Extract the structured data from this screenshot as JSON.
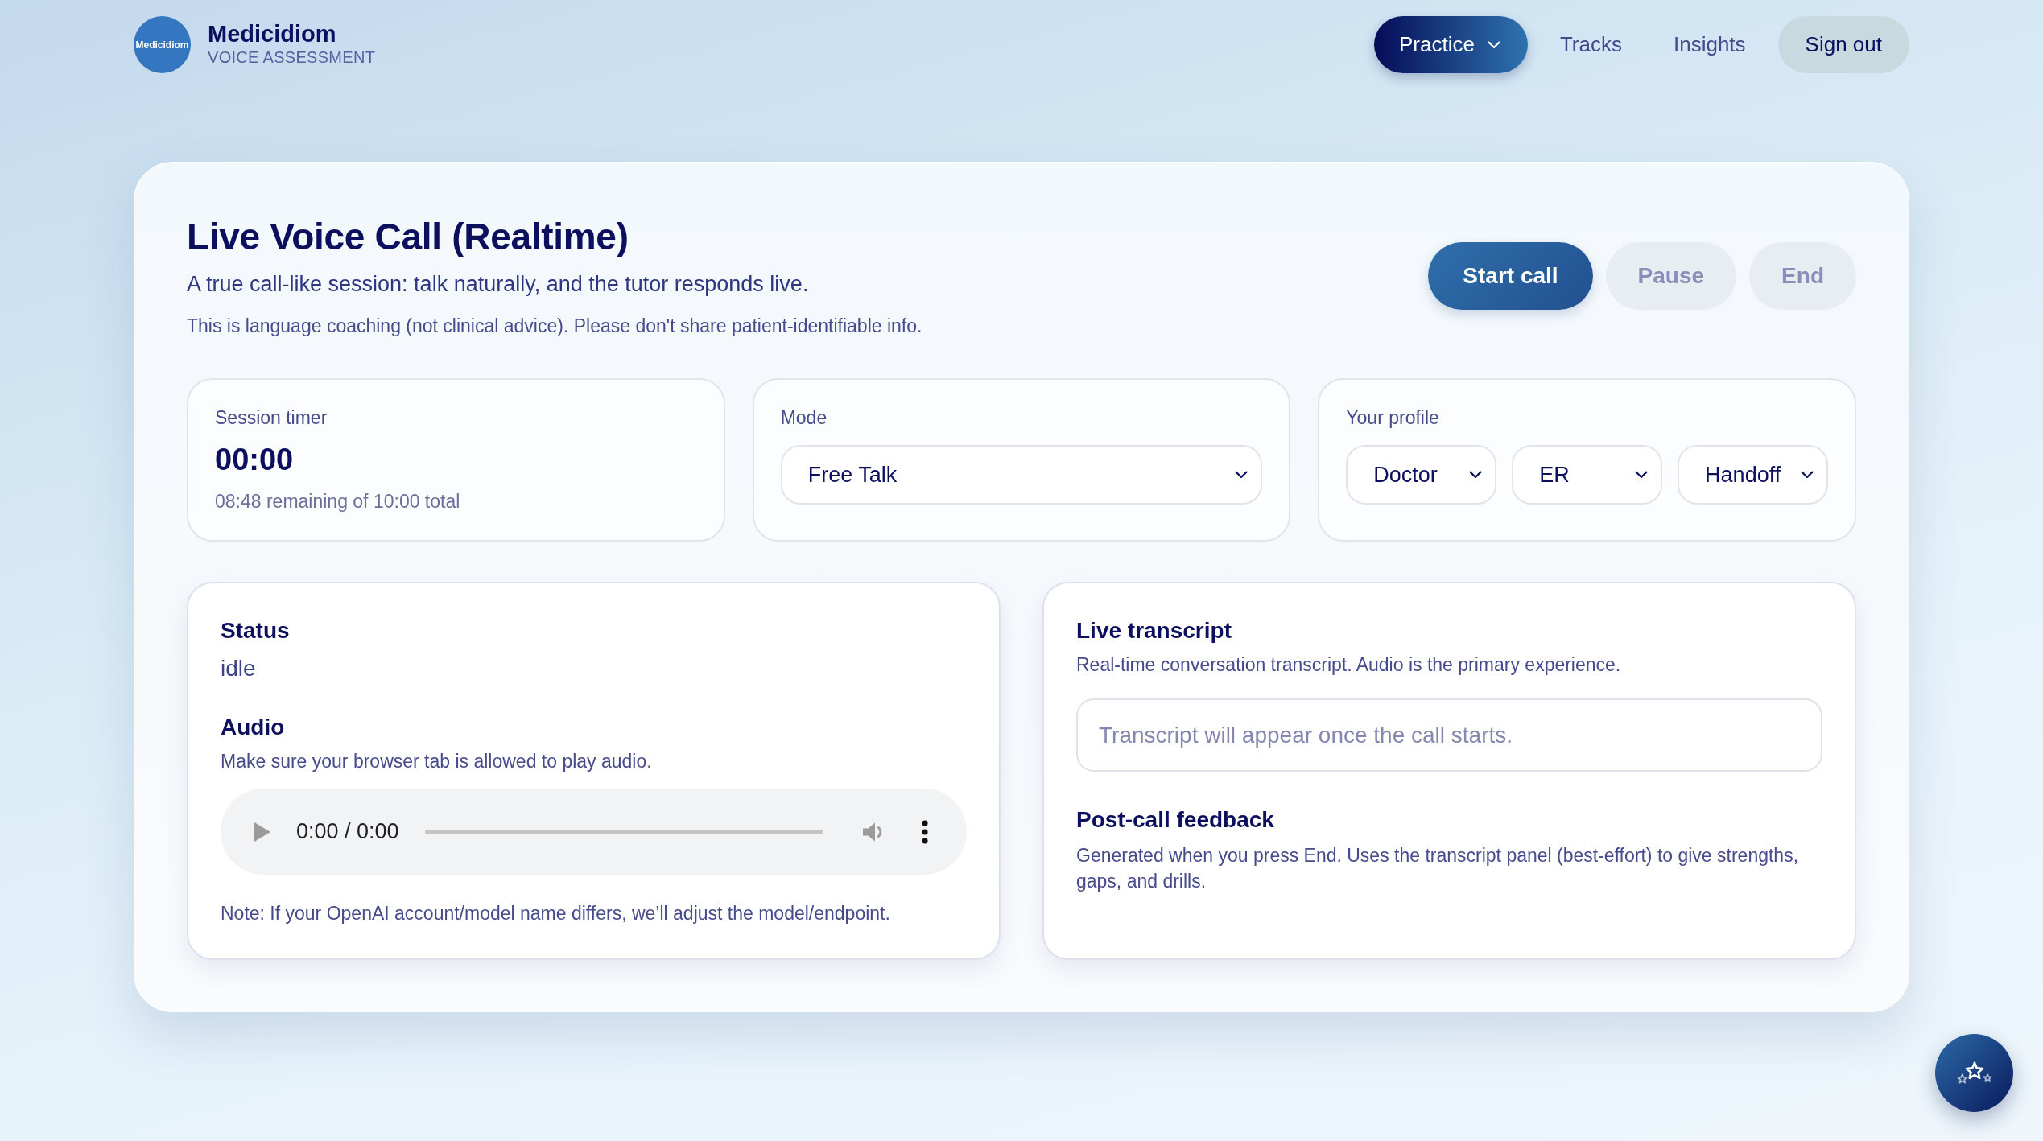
{
  "brand": {
    "logo_text": "Medicidiom",
    "name": "Medicidiom",
    "tagline": "VOICE ASSESSMENT"
  },
  "nav": {
    "items": [
      {
        "label": "Practice",
        "selected": true,
        "dropdown": true
      },
      {
        "label": "Tracks",
        "selected": false,
        "dropdown": false
      },
      {
        "label": "Insights",
        "selected": false,
        "dropdown": false
      }
    ],
    "sign_out": "Sign out"
  },
  "call_panel": {
    "title": "Live Voice Call (Realtime)",
    "subtitle": "A true call-like session: talk naturally, and the tutor responds live.",
    "disclaimer": "This is language coaching (not clinical advice). Please don't share patient-identifiable info.",
    "actions": [
      {
        "label": "Start call",
        "disabled": false
      },
      {
        "label": "Pause",
        "disabled": true
      },
      {
        "label": "End",
        "disabled": true
      }
    ],
    "session_timer": {
      "label": "Session timer",
      "time": "00:00",
      "remaining": "08:48 remaining of 10:00 total"
    },
    "mode": {
      "label": "Mode",
      "value": "Free Talk"
    },
    "profile": {
      "label": "Your profile",
      "selects": [
        "Doctor",
        "ER",
        "Handoff"
      ]
    },
    "status": {
      "heading": "Status",
      "value": "idle"
    },
    "audio": {
      "heading": "Audio",
      "hint": "Make sure your browser tab is allowed to play audio.",
      "time": "0:00 / 0:00",
      "note": "Note: If your OpenAI account/model name differs, we’ll adjust the model/endpoint."
    },
    "transcript": {
      "heading": "Live transcript",
      "description": "Real-time conversation transcript. Audio is the primary experience.",
      "placeholder": "Transcript will appear once the call starts."
    },
    "feedback": {
      "heading": "Post-call feedback",
      "description": "Generated when you press End. Uses the transcript panel (best-effort) to give strengths, gaps, and drills."
    }
  }
}
